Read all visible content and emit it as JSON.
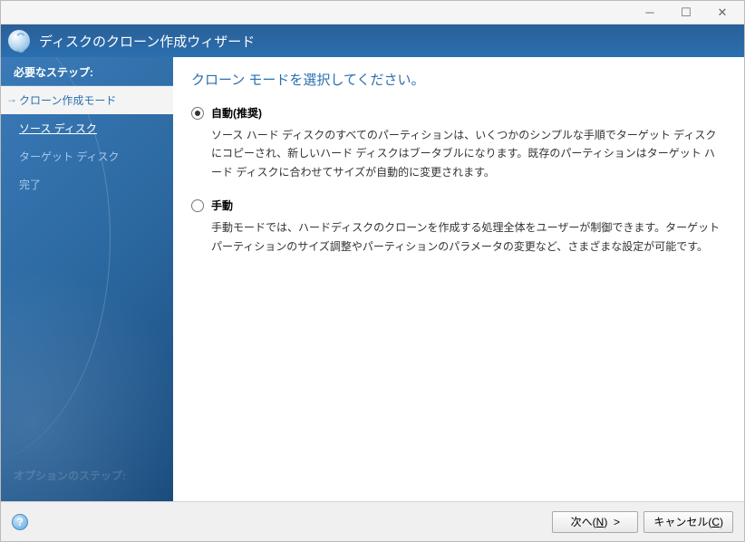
{
  "header": {
    "title": "ディスクのクローン作成ウィザード"
  },
  "sidebar": {
    "header": "必要なステップ:",
    "steps": [
      {
        "label": "クローン作成モード",
        "state": "current"
      },
      {
        "label": "ソース ディスク",
        "state": "done"
      },
      {
        "label": "ターゲット ディスク",
        "state": "pending"
      },
      {
        "label": "完了",
        "state": "pending"
      }
    ],
    "footer": "オプションのステップ:"
  },
  "main": {
    "heading": "クローン モードを選択してください。",
    "options": [
      {
        "id": "auto",
        "label": "自動(推奨)",
        "checked": true,
        "desc": "ソース ハード ディスクのすべてのパーティションは、いくつかのシンプルな手順でターゲット ディスクにコピーされ、新しいハード ディスクはブータブルになります。既存のパーティションはターゲット ハード ディスクに合わせてサイズが自動的に変更されます。"
      },
      {
        "id": "manual",
        "label": "手動",
        "checked": false,
        "desc": "手動モードでは、ハードディスクのクローンを作成する処理全体をユーザーが制御できます。ターゲット パーティションのサイズ調整やパーティションのパラメータの変更など、さまざまな設定が可能です。"
      }
    ]
  },
  "footer": {
    "next": "次へ(N) >",
    "cancel": "キャンセル(C)"
  }
}
